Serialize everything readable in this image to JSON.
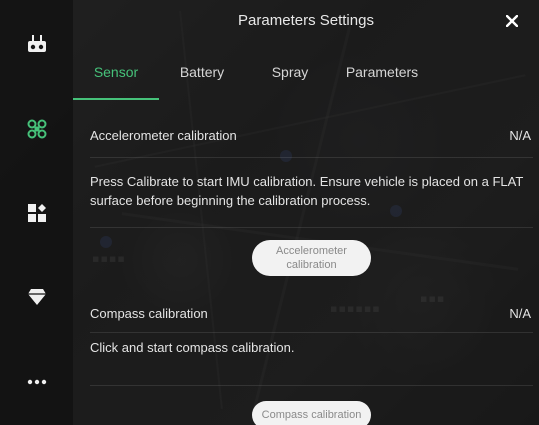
{
  "header": {
    "title": "Parameters Settings"
  },
  "tabs": [
    {
      "label": "Sensor",
      "active": true
    },
    {
      "label": "Battery",
      "active": false
    },
    {
      "label": "Spray",
      "active": false
    },
    {
      "label": "Parameters",
      "active": false
    }
  ],
  "sections": {
    "accelerometer": {
      "title": "Accelerometer calibration",
      "status": "N/A",
      "description": "Press Calibrate to start IMU calibration. Ensure vehicle is placed on a FLAT surface before beginning the calibration process.",
      "button_line1": "Accelerometer",
      "button_line2": "calibration"
    },
    "compass": {
      "title": "Compass calibration",
      "status": "N/A",
      "description": "Click and start compass calibration.",
      "button": "Compass calibration"
    }
  },
  "sidebar": {
    "items": [
      {
        "icon": "remote-controller-icon"
      },
      {
        "icon": "drone-icon",
        "color": "#46c27a"
      },
      {
        "icon": "widgets-icon"
      },
      {
        "icon": "diamond-icon"
      },
      {
        "icon": "more-icon"
      }
    ]
  },
  "colors": {
    "accent": "#46c27a",
    "text": "#e4e4e4",
    "button_bg": "#f2f2f2"
  }
}
